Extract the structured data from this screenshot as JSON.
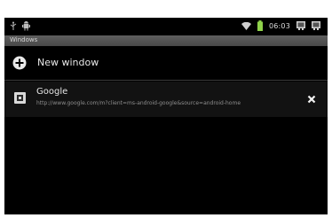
{
  "title_bar": {
    "label": "Windows"
  },
  "status_bar": {
    "left_icons": [
      "usb-icon",
      "android-debug-icon"
    ],
    "right_icons": [
      "wifi-icon",
      "battery-icon",
      "signal-icon",
      "notification-icon"
    ],
    "time": "06:03",
    "battery_color": "#8fd24a"
  },
  "new_window": {
    "label": "New window",
    "icon": "plus-circle-icon"
  },
  "tabs": [
    {
      "title": "Google",
      "url": "http://www.google.com/m?client=ms-android-google&source=android-home",
      "favicon": "google-favicon",
      "close_icon": "close-icon"
    }
  ]
}
